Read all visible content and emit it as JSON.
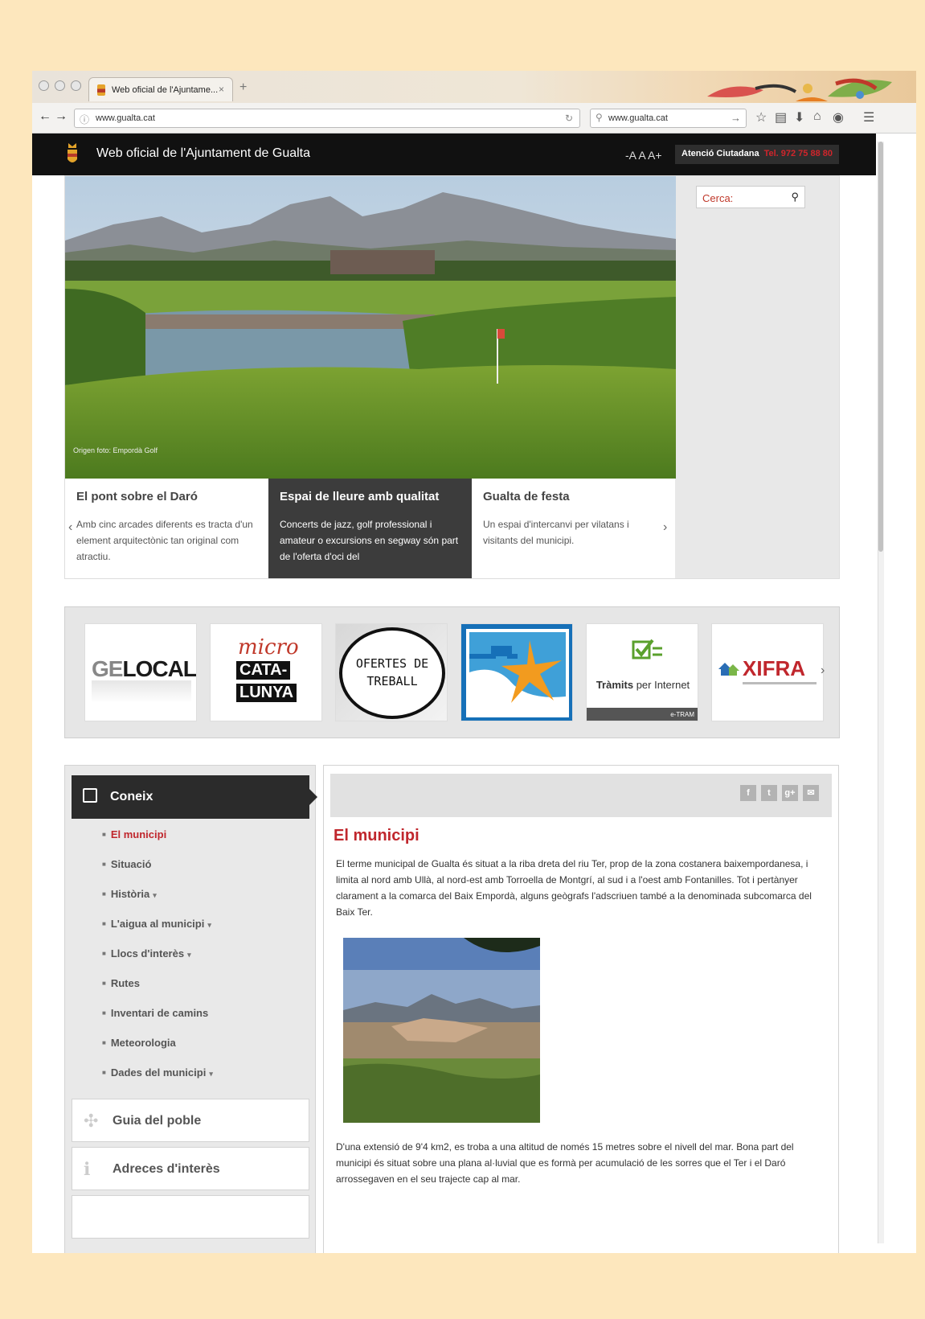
{
  "browser": {
    "tab_title": "Web oficial de l'Ajuntame...",
    "tab_close": "×",
    "new_tab": "+",
    "url": "www.gualta.cat",
    "search_query": "www.gualta.cat"
  },
  "header": {
    "site_title": "Web oficial de l'Ajuntament de Gualta",
    "font_size_control": "-A A A+",
    "atencio_label": "Atenció Ciutadana",
    "atencio_phone": "Tel. 972 75 88 80"
  },
  "hero": {
    "photo_caption": "Origen foto: Empordà Golf",
    "search_label": "Cerca:",
    "slides": [
      {
        "title": "El pont sobre el Daró",
        "text": "Amb cinc arcades diferents es tracta d'un element arquitectònic tan original com atractiu."
      },
      {
        "title": "Espai de lleure amb qualitat",
        "text": "Concerts de jazz, golf professional i amateur o excursions en segway són part de l'oferta d'oci del"
      },
      {
        "title": "Gualta de festa",
        "text": "Un espai d'intercanvi per vilatans i visitants del municipi."
      }
    ],
    "prev_arrow": "‹",
    "next_arrow": "›"
  },
  "logos": {
    "geolocal": {
      "geo": "GE",
      "local": "LOCAL"
    },
    "micro": {
      "top": "micro",
      "mid": "CATA-",
      "bot": "LUNYA"
    },
    "ofertes": {
      "line1": "OFERTES DE",
      "line2": "TREBALL"
    },
    "tramits": {
      "bold": "Tràmits",
      "rest": "per Internet",
      "tag": "e-TRAM"
    },
    "xifra": {
      "name": "XIFRA"
    },
    "next": "›"
  },
  "sidebar": {
    "header": "Coneix",
    "items": [
      {
        "label": "El municipi",
        "caret": ""
      },
      {
        "label": "Situació",
        "caret": ""
      },
      {
        "label": "Història",
        "caret": "▾"
      },
      {
        "label": "L'aigua al municipi",
        "caret": "▾"
      },
      {
        "label": "Llocs d'interès",
        "caret": "▾"
      },
      {
        "label": "Rutes",
        "caret": ""
      },
      {
        "label": "Inventari de camins",
        "caret": ""
      },
      {
        "label": "Meteorologia",
        "caret": ""
      },
      {
        "label": "Dades del municipi",
        "caret": "▾"
      }
    ],
    "guide": "Guia del poble",
    "addresses": "Adreces d'interès"
  },
  "content": {
    "share": {
      "facebook": "f",
      "twitter": "t",
      "gplus": "g+",
      "mail": "✉"
    },
    "title": "El municipi",
    "para1": "El terme municipal de Gualta és situat a la riba dreta del riu Ter, prop de la zona costanera baixempordanesa, i limita al nord amb Ullà, al nord-est amb Torroella de Montgrí, al sud i a l'oest amb Fontanilles. Tot i pertànyer clarament a la comarca del Baix Empordà, alguns geògrafs l'adscriuen també a la denominada subcomarca del Baix Ter.",
    "para2": "D'una extensió de 9'4 km2, es troba a una altitud de només 15 metres sobre el nivell del mar. Bona part del municipi és situat sobre una plana al·luvial que es formà per acumulació de les sorres que el Ter i el Daró arrossegaven en el seu trajecte cap al mar."
  },
  "colors": {
    "accent": "#c0272d",
    "header_bg": "#111111",
    "background": "#fde7bd"
  }
}
